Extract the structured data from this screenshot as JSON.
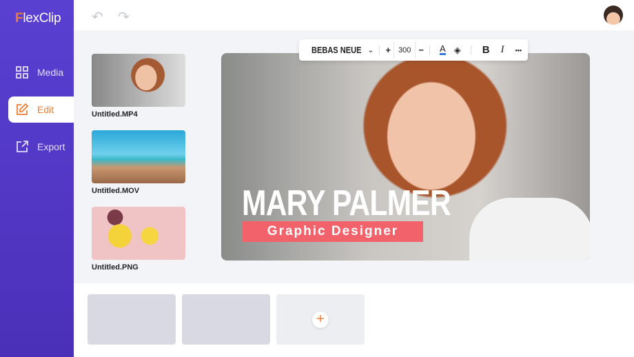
{
  "app": {
    "logo_f": "F",
    "logo_rest": "lexClip"
  },
  "sidebar": {
    "items": [
      {
        "label": "Media",
        "icon": "grid-icon"
      },
      {
        "label": "Edit",
        "icon": "edit-icon",
        "active": true
      },
      {
        "label": "Export",
        "icon": "export-icon"
      }
    ]
  },
  "topbar": {
    "undo": "↶",
    "redo": "↷"
  },
  "media": [
    {
      "label": "Untitled.MP4"
    },
    {
      "label": "Untitled.MOV"
    },
    {
      "label": "Untitled.PNG"
    }
  ],
  "toolbar": {
    "font": "BEBAS NEUE",
    "chevron": "⌄",
    "plus": "+",
    "size": "300",
    "minus": "−",
    "text_color_glyph": "A",
    "text_color": "#3a78d8",
    "fill_glyph": "◈",
    "bold": "B",
    "italic": "I",
    "more": "•••"
  },
  "preview": {
    "title": "MARY PALMER",
    "subtitle": "Graphic Designer"
  },
  "timeline": {
    "add": "+"
  },
  "colors": {
    "accent": "#ef7d33",
    "sidebar": "#5a40d2",
    "subtitle_bg": "#f2626a"
  }
}
